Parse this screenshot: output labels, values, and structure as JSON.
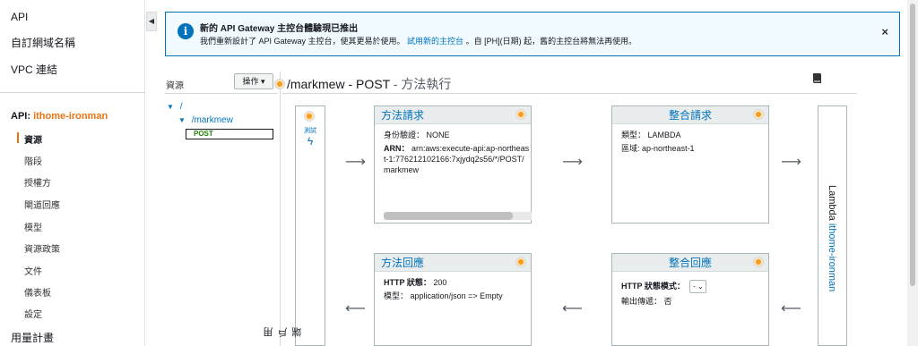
{
  "sidebar": {
    "top_items": [
      "API",
      "自訂網域名稱",
      "VPC 連結"
    ],
    "api_label": "API:",
    "api_name": "ithome-ironman",
    "sub_items": [
      "資源",
      "階段",
      "授權方",
      "閘道回應",
      "模型",
      "資源政策",
      "文件",
      "儀表板",
      "設定"
    ],
    "active_item": "資源",
    "bottom_item": "用量計畫"
  },
  "banner": {
    "title": "新的 API Gateway 主控台體驗現已推出",
    "text_before": "我們重新設計了 API Gateway 主控台，使其更易於使用。",
    "link": "試用新的主控台",
    "text_after": "。自 [PH](日期) 起，舊的主控台將無法再使用。",
    "close": "×"
  },
  "resources": {
    "label": "資源",
    "ops_button": "操作",
    "tree_root": "/",
    "tree_child": "/markmew",
    "method": "POST"
  },
  "title": {
    "path": "/markmew - POST",
    "suffix": " - 方法執行"
  },
  "client": {
    "test_label": "測試",
    "name": "用戶端"
  },
  "method_request": {
    "title": "方法請求",
    "auth_label": "身份驗證：",
    "auth_value": "NONE",
    "arn_label": "ARN：",
    "arn_value": "arn:aws:execute-api:ap-northeast-1:776212102166:7xjydq2s56/*/POST/markmew"
  },
  "integration_request": {
    "title": "整合請求",
    "type_label": "類型：",
    "type_value": "LAMBDA",
    "region_label": "區域:",
    "region_value": "ap-northeast-1"
  },
  "method_response": {
    "title": "方法回應",
    "status_label": "HTTP 狀態：",
    "status_value": "200",
    "model_label": "模型：",
    "model_value": "application/json => Empty"
  },
  "integration_response": {
    "title": "整合回應",
    "mode_label": "HTTP 狀態模式：",
    "mode_value": "-",
    "passthrough_label": "輸出傳遞：",
    "passthrough_value": "否"
  },
  "lambda": {
    "label": "Lambda ",
    "function": "ithome-ironman"
  }
}
